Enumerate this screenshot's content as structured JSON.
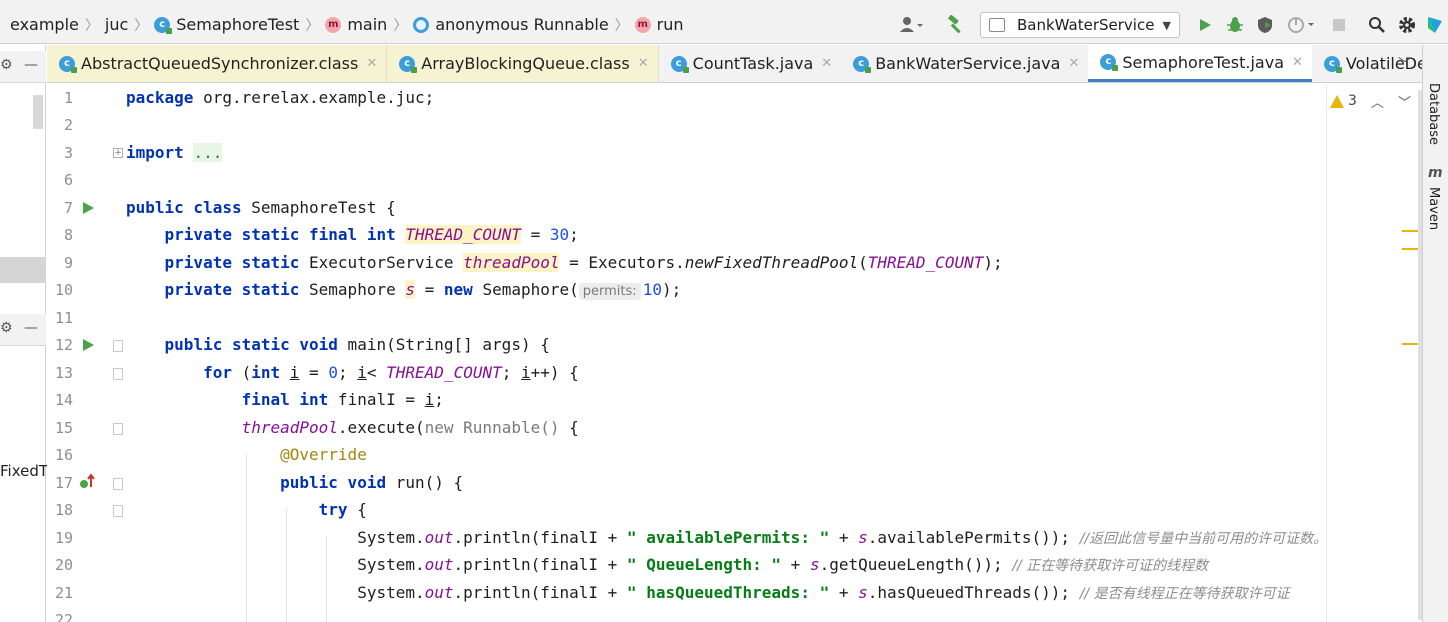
{
  "breadcrumb": [
    {
      "label": "example",
      "icon": "none"
    },
    {
      "label": "juc",
      "icon": "none"
    },
    {
      "label": "SemaphoreTest",
      "icon": "class-icon"
    },
    {
      "label": "main",
      "icon": "method-icon"
    },
    {
      "label": "anonymous Runnable",
      "icon": "anonymous-class-icon"
    },
    {
      "label": "run",
      "icon": "method-icon"
    }
  ],
  "method_letter": "m",
  "class_letter": "c",
  "toolbar": {
    "run_config": "BankWaterService"
  },
  "tabs": [
    {
      "label": "AbstractQueuedSynchronizer.class",
      "type": "classfile"
    },
    {
      "label": "ArrayBlockingQueue.class",
      "type": "classfile"
    },
    {
      "label": "CountTask.java",
      "type": "source"
    },
    {
      "label": "BankWaterService.java",
      "type": "source"
    },
    {
      "label": "SemaphoreTest.java",
      "type": "source",
      "active": true
    },
    {
      "label": "VolatileDemo.java",
      "type": "source"
    }
  ],
  "left_panel": {
    "partial_text": "FixedT"
  },
  "right_stripe": {
    "database_label": "Database",
    "maven_label": "Maven",
    "maven_icon_letter": "m"
  },
  "inspections": {
    "warning_count": "3"
  },
  "line_numbers": [
    "1",
    "2",
    "3",
    "6",
    "7",
    "8",
    "9",
    "10",
    "11",
    "12",
    "13",
    "14",
    "15",
    "16",
    "17",
    "18",
    "19",
    "20",
    "21",
    "22"
  ],
  "code": {
    "l1": {
      "kw": "package",
      "rest": " org.rerelax.example.juc;"
    },
    "l3": {
      "kw": "import",
      "folded": "..."
    },
    "l7": {
      "kw": "public class",
      "rest": " SemaphoreTest {"
    },
    "l8": {
      "kw": "private static final int",
      "field": "THREAD_COUNT",
      "op": " = ",
      "num": "30",
      "end": ";"
    },
    "l9": {
      "kw": "private static",
      "type": " ExecutorService ",
      "field": "threadPool",
      "op": " = Executors.",
      "call": "newFixedThreadPool",
      "open": "(",
      "arg": "THREAD_COUNT",
      "end": ");"
    },
    "l10": {
      "kw": "private static",
      "type": " Semaphore ",
      "field": "s",
      "op": " = ",
      "kw2": "new",
      "ctor": " Semaphore(",
      "hint": "permits:",
      "num": "10",
      "end": ");"
    },
    "l12": {
      "kw": "public static void",
      "rest": " main(String[] args) {"
    },
    "l13": {
      "kw": "for",
      "p1": " (",
      "kw2": "int",
      "p2": " ",
      "var": "i",
      "p3": " = ",
      "num": "0",
      "p4": "; ",
      "var2": "i",
      "p5": "< ",
      "field": "THREAD_COUNT",
      "p6": "; ",
      "var3": "i",
      "p7": "++) {"
    },
    "l14": {
      "kw": "final int",
      "p1": " finalI = ",
      "var": "i",
      "p2": ";"
    },
    "l15": {
      "field": "threadPool",
      "p1": ".execute(",
      "kw": "new",
      "p2": " Runnable()",
      "p3": " {"
    },
    "l16": {
      "ann": "@Override"
    },
    "l17": {
      "kw": "public void",
      "rest": " run() {"
    },
    "l18": {
      "kw": "try",
      "rest": " {"
    },
    "l19": {
      "p1": "System.",
      "out": "out",
      "p2": ".println(finalI + ",
      "str": "\" availablePermits: \"",
      "p3": " + ",
      "s": "s",
      "p4": ".availablePermits()); ",
      "cmt": "//返回此信号量中当前可用的许可证数。"
    },
    "l20": {
      "p1": "System.",
      "out": "out",
      "p2": ".println(finalI + ",
      "str": "\" QueueLength: \"",
      "p3": " + ",
      "s": "s",
      "p4": ".getQueueLength()); ",
      "cmt": "// 正在等待获取许可证的线程数"
    },
    "l21": {
      "p1": "System.",
      "out": "out",
      "p2": ".println(finalI + ",
      "str": "\" hasQueuedThreads: \"",
      "p3": " + ",
      "s": "s",
      "p4": ".hasQueuedThreads()); ",
      "cmt": "// 是否有线程正在等待获取许可证"
    }
  },
  "colors": {
    "keyword": "#0033b3",
    "field": "#871094",
    "number": "#1750eb",
    "string": "#067d17",
    "annotation": "#9e880d",
    "comment": "#8c8c8c",
    "tab_accent": "#4083c9",
    "warning": "#e5b50b"
  }
}
